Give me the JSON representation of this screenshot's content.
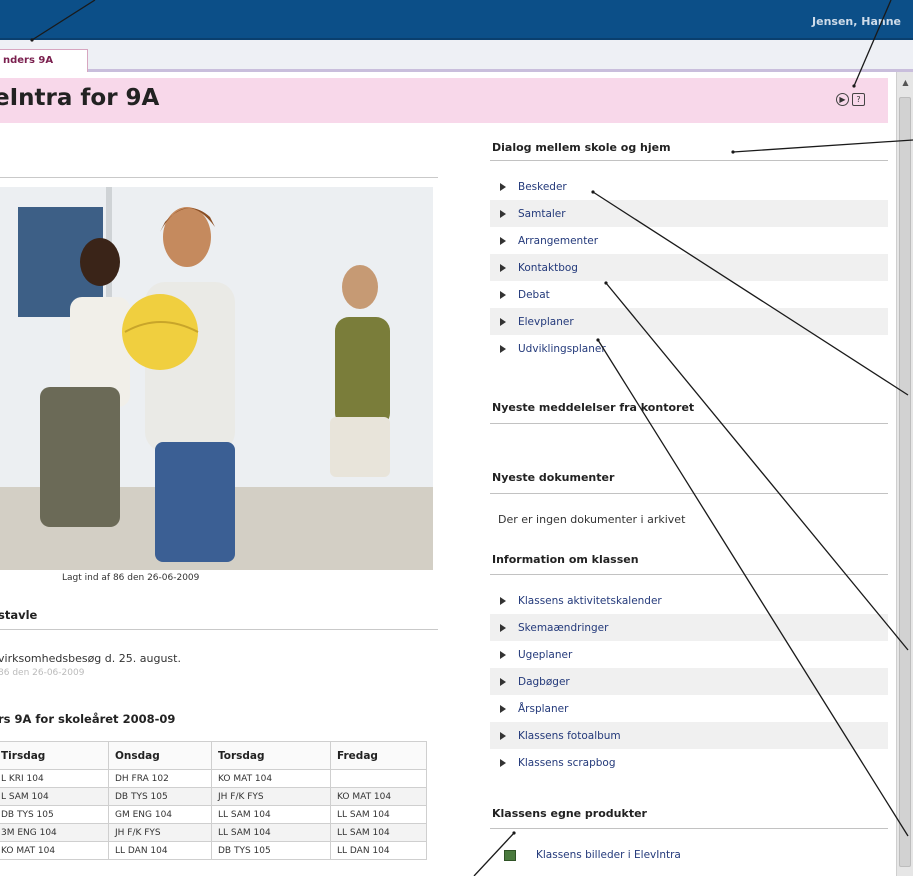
{
  "header": {
    "user_name": "Jensen, Hanne"
  },
  "tab": {
    "label": "nders 9A"
  },
  "page": {
    "title": "eIntra for 9A",
    "icons": [
      "play-icon",
      "help-icon"
    ]
  },
  "left": {
    "photo_caption": "Lagt ind af 86 den 26-06-2009",
    "news_title": "stavle",
    "news_text": "virksomhedsbesøg d. 25. august.",
    "news_meta": "86 den 26-06-2009",
    "schedule_title": "rs 9A for skoleåret 2008-09",
    "schedule": {
      "headers": [
        "Tirsdag",
        "Onsdag",
        "Torsdag",
        "Fredag"
      ],
      "rows": [
        [
          "L KRI 104",
          "DH FRA 102",
          "KO MAT 104",
          ""
        ],
        [
          "L SAM 104",
          "DB TYS 105",
          "JH F/K FYS",
          "KO MAT 104"
        ],
        [
          "DB TYS 105",
          "GM ENG 104",
          "LL SAM 104",
          "LL SAM 104"
        ],
        [
          "3M ENG 104",
          "JH F/K FYS",
          "LL SAM 104",
          "LL SAM 104"
        ],
        [
          "KO MAT 104",
          "LL DAN 104",
          "DB TYS 105",
          "LL DAN 104"
        ]
      ]
    }
  },
  "right": {
    "dialog_title": "Dialog mellem skole og hjem",
    "dialog_links": [
      "Beskeder",
      "Samtaler",
      "Arrangementer",
      "Kontaktbog",
      "Debat",
      "Elevplaner",
      "Udviklingsplaner"
    ],
    "office_title": "Nyeste meddelelser fra kontoret",
    "docs_title": "Nyeste dokumenter",
    "docs_empty": "Der er ingen dokumenter i arkivet",
    "class_info_title": "Information om klassen",
    "class_links": [
      "Klassens aktivitetskalender",
      "Skemaændringer",
      "Ugeplaner",
      "Dagbøger",
      "Årsplaner",
      "Klassens fotoalbum",
      "Klassens scrapbog"
    ],
    "products_title": "Klassens egne produkter",
    "products_link": "Klassens billeder i ElevIntra"
  },
  "colors": {
    "topbar": "#0c4f88",
    "title_band": "#f8d8ea",
    "link": "#23397a"
  }
}
